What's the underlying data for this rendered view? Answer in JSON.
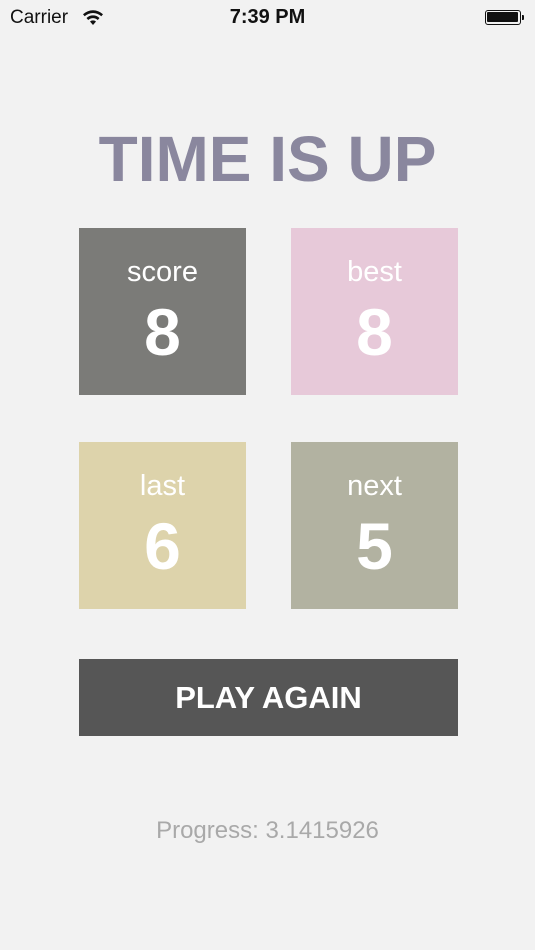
{
  "status_bar": {
    "carrier": "Carrier",
    "time": "7:39 PM",
    "wifi_icon": "wifi-icon",
    "battery_icon": "battery-icon",
    "battery_level": 1.0
  },
  "title": "TIME IS UP",
  "tiles": {
    "score": {
      "label": "score",
      "value": "8",
      "color": "#7b7b78"
    },
    "best": {
      "label": "best",
      "value": "8",
      "color": "#e7c9d9"
    },
    "last": {
      "label": "last",
      "value": "6",
      "color": "#ddd3ab"
    },
    "next": {
      "label": "next",
      "value": "5",
      "color": "#b2b2a1"
    }
  },
  "play_again": {
    "label": "PLAY AGAIN",
    "color": "#565656"
  },
  "progress_text": "Progress: 3.1415926",
  "colors": {
    "background": "#f2f2f2",
    "title": "#8a879e",
    "progress_text": "#a9a9a9"
  }
}
